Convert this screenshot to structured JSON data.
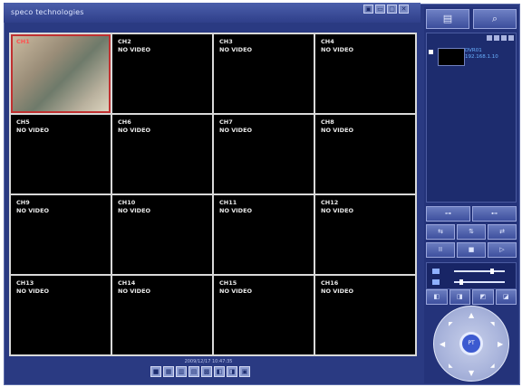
{
  "title": {
    "logo_text": "speco technologies"
  },
  "window_controls": [
    "▣",
    "▭",
    "▢",
    "✕"
  ],
  "channels": [
    {
      "name": "CH1",
      "status": ""
    },
    {
      "name": "CH2",
      "status": "NO VIDEO"
    },
    {
      "name": "CH3",
      "status": "NO VIDEO"
    },
    {
      "name": "CH4",
      "status": "NO VIDEO"
    },
    {
      "name": "CH5",
      "status": "NO VIDEO"
    },
    {
      "name": "CH6",
      "status": "NO VIDEO"
    },
    {
      "name": "CH7",
      "status": "NO VIDEO"
    },
    {
      "name": "CH8",
      "status": "NO VIDEO"
    },
    {
      "name": "CH9",
      "status": "NO VIDEO"
    },
    {
      "name": "CH10",
      "status": "NO VIDEO"
    },
    {
      "name": "CH11",
      "status": "NO VIDEO"
    },
    {
      "name": "CH12",
      "status": "NO VIDEO"
    },
    {
      "name": "CH13",
      "status": "NO VIDEO"
    },
    {
      "name": "CH14",
      "status": "NO VIDEO"
    },
    {
      "name": "CH15",
      "status": "NO VIDEO"
    },
    {
      "name": "CH16",
      "status": "NO VIDEO"
    }
  ],
  "bottom": {
    "timestamp": "2009/12/17 10:47:35"
  },
  "layout_buttons": [
    "■",
    "▦",
    "▥",
    "▤",
    "▩",
    "◧",
    "◨",
    "▣"
  ],
  "right_panel": {
    "tab1": "▤",
    "tab2": "⌕",
    "device": {
      "line1": "DVR01",
      "line2": "192.168.1.10"
    },
    "buttons_row1": [
      "⊶",
      "⊷"
    ],
    "buttons_row2": [
      "⇆",
      "⇅",
      "⇄"
    ],
    "buttons_row3": [
      "II",
      "■",
      "▷"
    ],
    "buttons_row4": [
      "◧",
      "◨",
      "◩",
      "◪"
    ],
    "ptz_label": "PT"
  }
}
